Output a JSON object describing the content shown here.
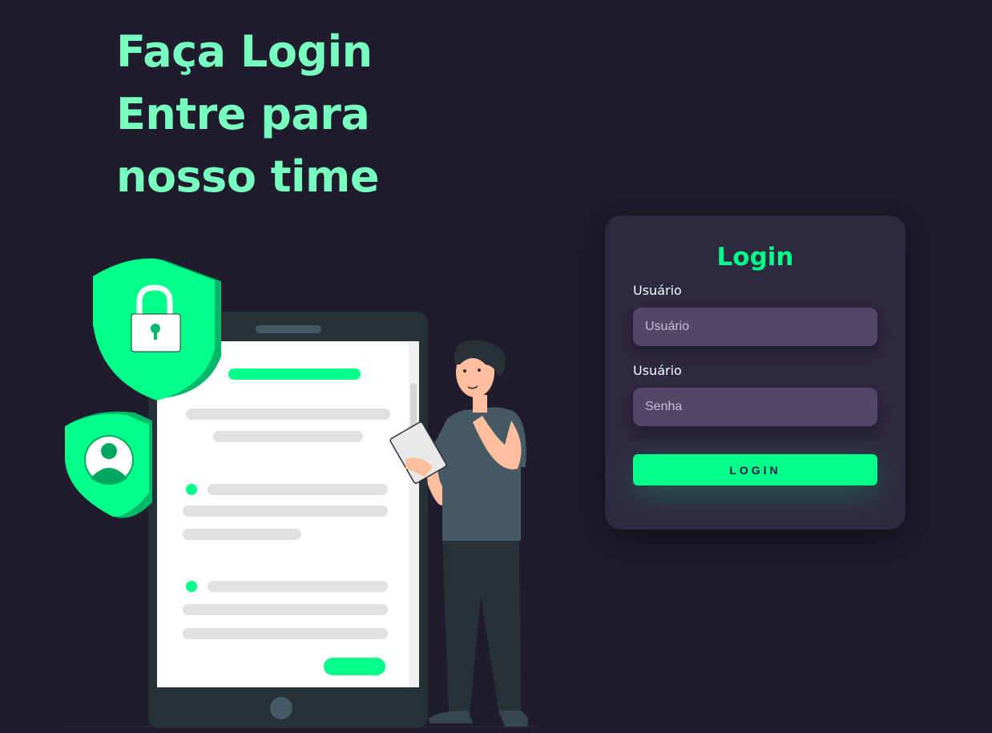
{
  "hero": {
    "line1": "Faça Login",
    "line2": "Entre para",
    "line3": "nosso time"
  },
  "login_card": {
    "title": "Login",
    "username": {
      "label": "Usuário",
      "placeholder": "Usuário",
      "value": ""
    },
    "password": {
      "label": "Usuário",
      "placeholder": "Senha",
      "value": ""
    },
    "submit_label": "Login"
  },
  "colors": {
    "background": "#201b2d",
    "headline": "#77ffc0",
    "accent": "#00ff88",
    "card": "#2f2841",
    "input": "#514869"
  },
  "illustration": {
    "icons": [
      "shield-lock-icon",
      "shield-user-icon",
      "tablet-document-icon",
      "person-thinking-icon"
    ]
  }
}
